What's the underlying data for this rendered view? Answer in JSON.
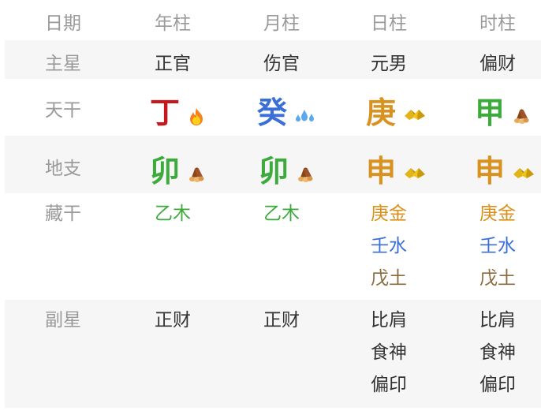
{
  "header": {
    "label": "日期",
    "columns": [
      "年柱",
      "月柱",
      "日柱",
      "时柱"
    ]
  },
  "rows": {
    "zhuxing": {
      "label": "主星",
      "values": [
        "正官",
        "伤官",
        "元男",
        "偏财"
      ]
    },
    "tiangan": {
      "label": "天干",
      "values": [
        {
          "char": "丁",
          "color": "#c8161d",
          "element_icon": "fire-icon"
        },
        {
          "char": "癸",
          "color": "#3a6fd8",
          "element_icon": "water-drops-icon"
        },
        {
          "char": "庚",
          "color": "#d9921f",
          "element_icon": "gold-pyramid-icon"
        },
        {
          "char": "甲",
          "color": "#3cab3c",
          "element_icon": "wood-logs-icon"
        }
      ]
    },
    "dizhi": {
      "label": "地支",
      "values": [
        {
          "char": "卯",
          "color": "#3cab3c",
          "element_icon": "wood-logs-icon"
        },
        {
          "char": "卯",
          "color": "#3cab3c",
          "element_icon": "wood-logs-icon"
        },
        {
          "char": "申",
          "color": "#d9921f",
          "element_icon": "gold-pyramid-icon"
        },
        {
          "char": "申",
          "color": "#d9921f",
          "element_icon": "gold-pyramid-icon"
        }
      ]
    },
    "canggan": {
      "label": "藏干",
      "values": [
        [
          {
            "text": "乙木",
            "color": "#3cab3c"
          }
        ],
        [
          {
            "text": "乙木",
            "color": "#3cab3c"
          }
        ],
        [
          {
            "text": "庚金",
            "color": "#d9921f"
          },
          {
            "text": "壬水",
            "color": "#3a6fd8"
          },
          {
            "text": "戊土",
            "color": "#8b6a3e"
          }
        ],
        [
          {
            "text": "庚金",
            "color": "#d9921f"
          },
          {
            "text": "壬水",
            "color": "#3a6fd8"
          },
          {
            "text": "戊土",
            "color": "#8b6a3e"
          }
        ]
      ]
    },
    "fuxing": {
      "label": "副星",
      "values": [
        [
          "正财"
        ],
        [
          "正财"
        ],
        [
          "比肩",
          "食神",
          "偏印"
        ],
        [
          "比肩",
          "食神",
          "偏印"
        ]
      ]
    }
  },
  "colors": {
    "label_gray": "#9a9a9a",
    "row_gray_bg": "#f6f6f6",
    "text_dark": "#333333"
  }
}
